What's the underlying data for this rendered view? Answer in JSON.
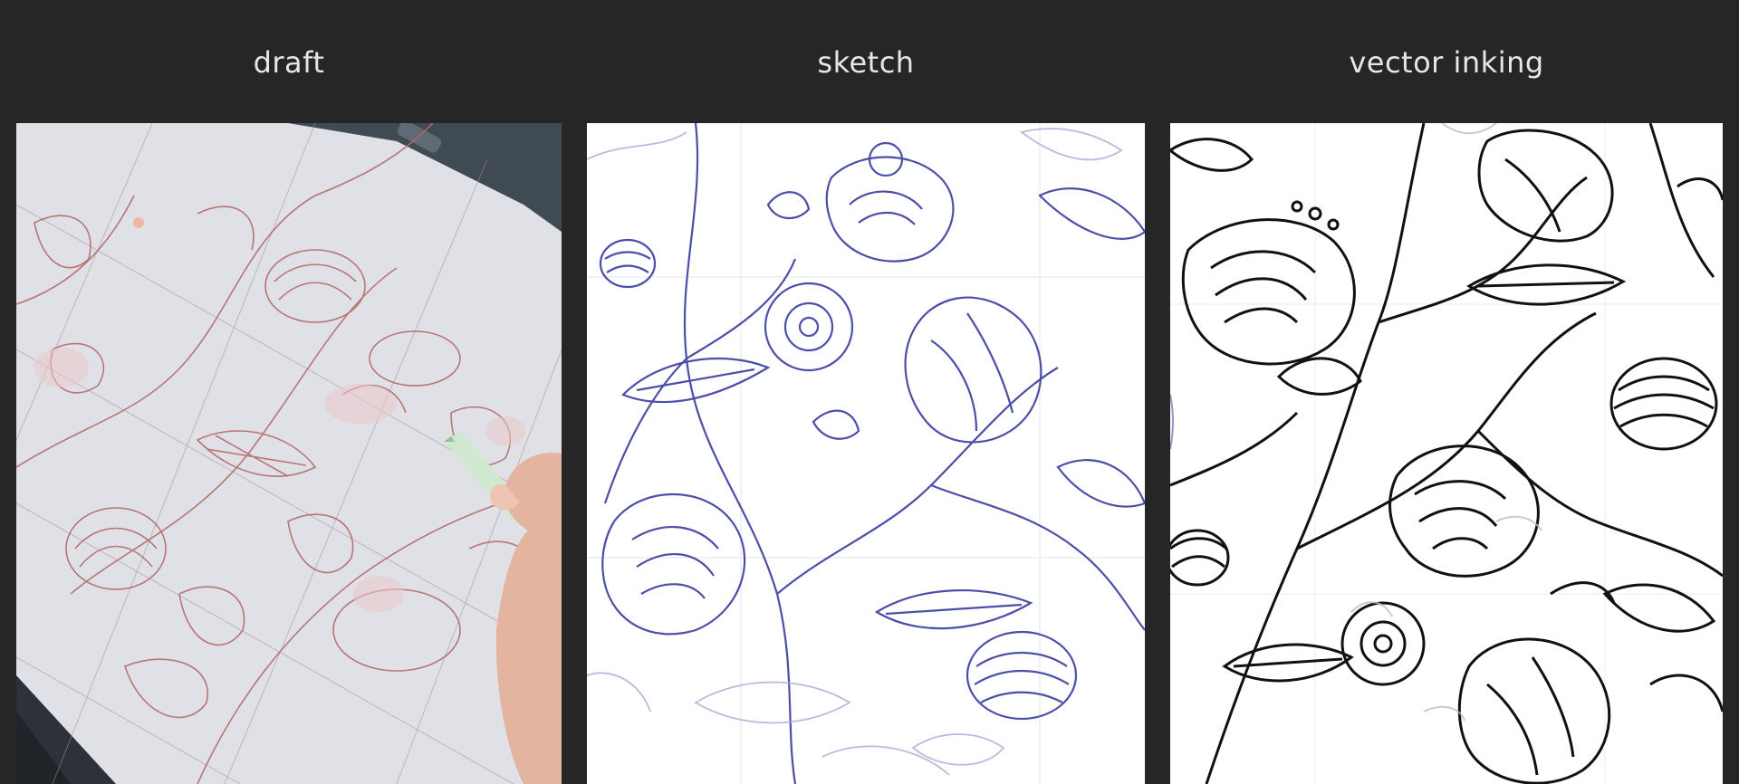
{
  "panels": [
    {
      "label": "draft",
      "line_color": "#b46a6a",
      "paper_color": "#dfe1e6"
    },
    {
      "label": "sketch",
      "line_color": "#4b4fa8",
      "paper_color": "#ffffff"
    },
    {
      "label": "vector inking",
      "line_color": "#111111",
      "paper_color": "#ffffff"
    }
  ]
}
